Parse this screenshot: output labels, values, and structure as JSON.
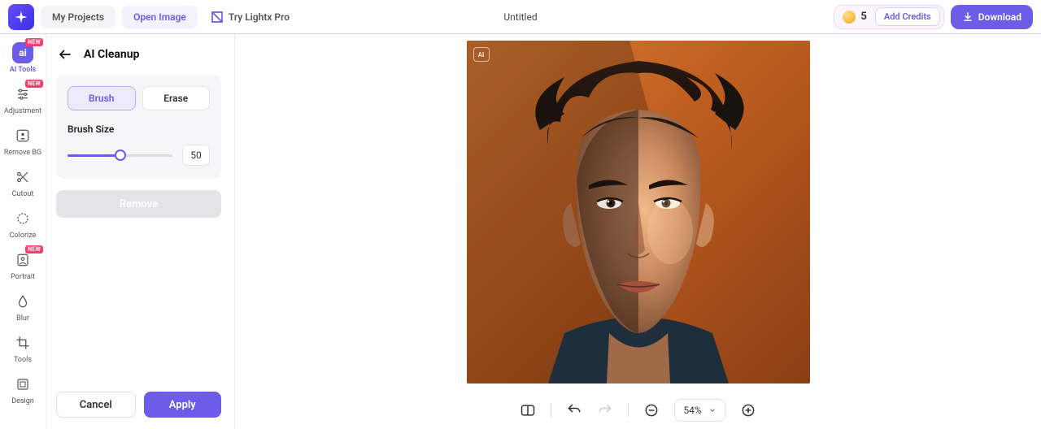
{
  "topbar": {
    "my_projects": "My Projects",
    "open_image": "Open Image",
    "try_pro": "Try Lightx Pro",
    "doc_title": "Untitled",
    "credits_count": "5",
    "add_credits": "Add Credits",
    "download": "Download"
  },
  "rail": {
    "items": [
      {
        "label": "AI Tools",
        "new": true,
        "active": true,
        "icon": "ai"
      },
      {
        "label": "Adjustment",
        "new": true,
        "active": false,
        "icon": "adjust"
      },
      {
        "label": "Remove BG",
        "new": false,
        "active": false,
        "icon": "removebg"
      },
      {
        "label": "Cutout",
        "new": false,
        "active": false,
        "icon": "cutout"
      },
      {
        "label": "Colorize",
        "new": false,
        "active": false,
        "icon": "colorize"
      },
      {
        "label": "Portrait",
        "new": true,
        "active": false,
        "icon": "portrait"
      },
      {
        "label": "Blur",
        "new": false,
        "active": false,
        "icon": "blur"
      },
      {
        "label": "Tools",
        "new": false,
        "active": false,
        "icon": "tools"
      },
      {
        "label": "Design",
        "new": false,
        "active": false,
        "icon": "design"
      }
    ],
    "new_badge": "NEW"
  },
  "panel": {
    "title": "AI Cleanup",
    "mode_brush": "Brush",
    "mode_erase": "Erase",
    "brush_size_label": "Brush Size",
    "brush_size_value": "50",
    "brush_size_percent": 50,
    "remove": "Remove",
    "cancel": "Cancel",
    "apply": "Apply"
  },
  "canvas": {
    "ai_tag": "AI"
  },
  "bottombar": {
    "zoom": "54%"
  }
}
